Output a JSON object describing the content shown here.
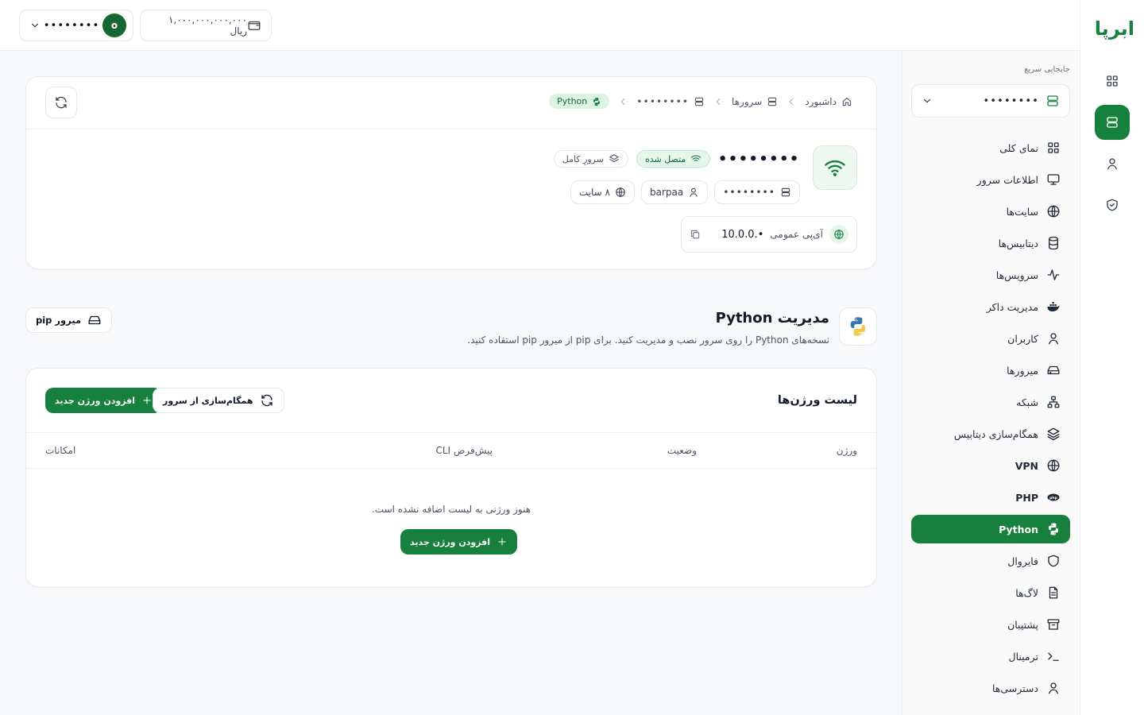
{
  "topbar": {
    "user_name": "••••••••",
    "avatar_initial": "o",
    "wallet_balance": "۱,۰۰۰,۰۰۰,۰۰۰,۰۰۰ ریال"
  },
  "brand": {
    "logo_text": "ابرپا"
  },
  "sidenav": {
    "quick_label": "جابجایی سریع",
    "quick_value": "••••••••",
    "items": [
      {
        "label": "نمای کلی",
        "icon": "grid-icon"
      },
      {
        "label": "اطلاعات سرور",
        "icon": "monitor-icon"
      },
      {
        "label": "سایت‌ها",
        "icon": "globe-icon"
      },
      {
        "label": "دیتابیس‌ها",
        "icon": "database-icon"
      },
      {
        "label": "سرویس‌ها",
        "icon": "activity-icon"
      },
      {
        "label": "مدیریت داکر",
        "icon": "docker-icon"
      },
      {
        "label": "کاربران",
        "icon": "user-icon"
      },
      {
        "label": "میرورها",
        "icon": "hard-drive-icon"
      },
      {
        "label": "شبکه",
        "icon": "network-icon"
      },
      {
        "label": "همگام‌سازی دیتابیس",
        "icon": "layers-icon"
      },
      {
        "label": "VPN",
        "icon": "globe-lock-icon"
      },
      {
        "label": "PHP",
        "icon": "php-icon"
      },
      {
        "label": "Python",
        "icon": "python-icon"
      },
      {
        "label": "فایروال",
        "icon": "shield-icon"
      },
      {
        "label": "لاگ‌ها",
        "icon": "file-text-icon"
      },
      {
        "label": "پشتیبان",
        "icon": "archive-icon"
      },
      {
        "label": "ترمینال",
        "icon": "terminal-icon"
      },
      {
        "label": "دسترسی‌ها",
        "icon": "user-icon"
      }
    ],
    "active_index": 12
  },
  "breadcrumb": {
    "home": "داشبورد",
    "servers": "سرورها",
    "server": "••••••••",
    "current": "Python"
  },
  "server": {
    "name": "••••••••",
    "status": "متصل شده",
    "plan": "سرورِ کامل",
    "host": "••••••••",
    "user": "barpaa",
    "sites": "۸ سایت",
    "ip_label": "آی‌پی عمومی",
    "ip_value": "10.0.0.•"
  },
  "section": {
    "title": "مدیریت Python",
    "description": "نسخه‌های Python را روی سرور نصب و مدیریت کنید. برای pip از میرور pip استفاده کنید.",
    "pip_button": "میرور pip"
  },
  "versions": {
    "title": "لیست ورژن‌ها",
    "sync_button": "همگام‌سازی از سرور",
    "add_button": "افزودن ورژن جدید",
    "columns": [
      "ورژن",
      "وضعیت",
      "پیش‌فرض CLI",
      "امکانات"
    ],
    "empty_text": "هنوز ورژنی به لیست اضافه نشده است.",
    "empty_add_button": "افزودن ورژن جدید"
  },
  "colors": {
    "accent": "#16803c",
    "accent_light": "#e4f7ea"
  }
}
